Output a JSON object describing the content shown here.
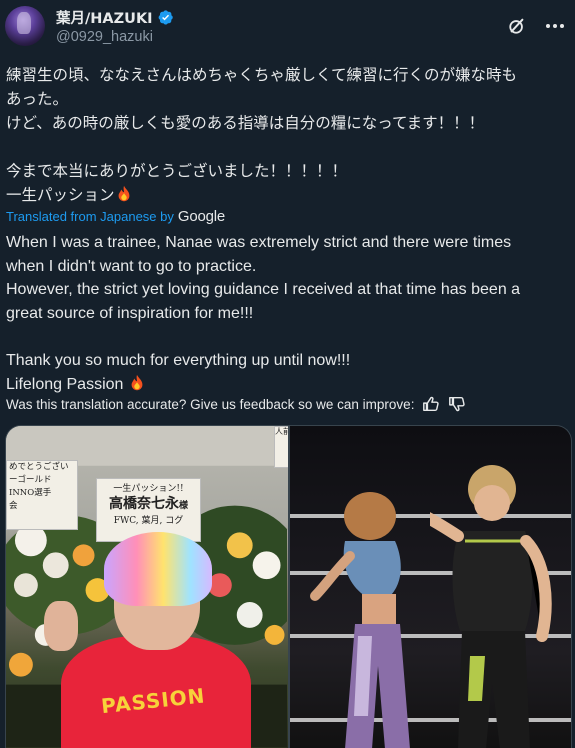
{
  "author": {
    "display_name": "葉月/HAZUKI",
    "handle": "@0929_hazuki",
    "verified": true
  },
  "header_icons": {
    "grok": "grok-icon",
    "more": "more-icon"
  },
  "original_text": {
    "lines": [
      "練習生の頃、ななえさんはめちゃくちゃ厳しくて練習に行くのが嫌な時も",
      "あった。",
      "けど、あの時の厳しくも愛のある指導は自分の糧になってます！！！",
      "",
      "今まで本当にありがとうございました！！！！！",
      "一生パッション"
    ]
  },
  "translation": {
    "label": "Translated from Japanese by",
    "provider": "Google",
    "lines": [
      "When I was a trainee, Nanae was extremely strict and there were times",
      "when I didn't want to go to practice.",
      "However, the strict yet loving guidance I received at that time has been a",
      "great source of inspiration for me!!!",
      "",
      "Thank you so much for everything up until now!!!",
      "Lifelong Passion"
    ]
  },
  "feedback": {
    "text": "Was this translation accurate? Give us feedback so we can improve:"
  },
  "media": {
    "left_photo": {
      "card_main_top": "一生パッション!!",
      "card_main_name": "高橋奈七永",
      "card_main_suffix": "様",
      "card_main_from": "FWC, 葉月, コグ",
      "card_left_lines": [
        "めでとうござい",
        "ーゴールド",
        "INNO選手",
        "会"
      ],
      "card_corner": "人前",
      "shirt_text": "PASSION"
    }
  },
  "colors": {
    "background": "#15202b",
    "text": "#e7e9ea",
    "muted": "#8b98a5",
    "link": "#1d9bf0",
    "verified": "#1d9bf0"
  }
}
